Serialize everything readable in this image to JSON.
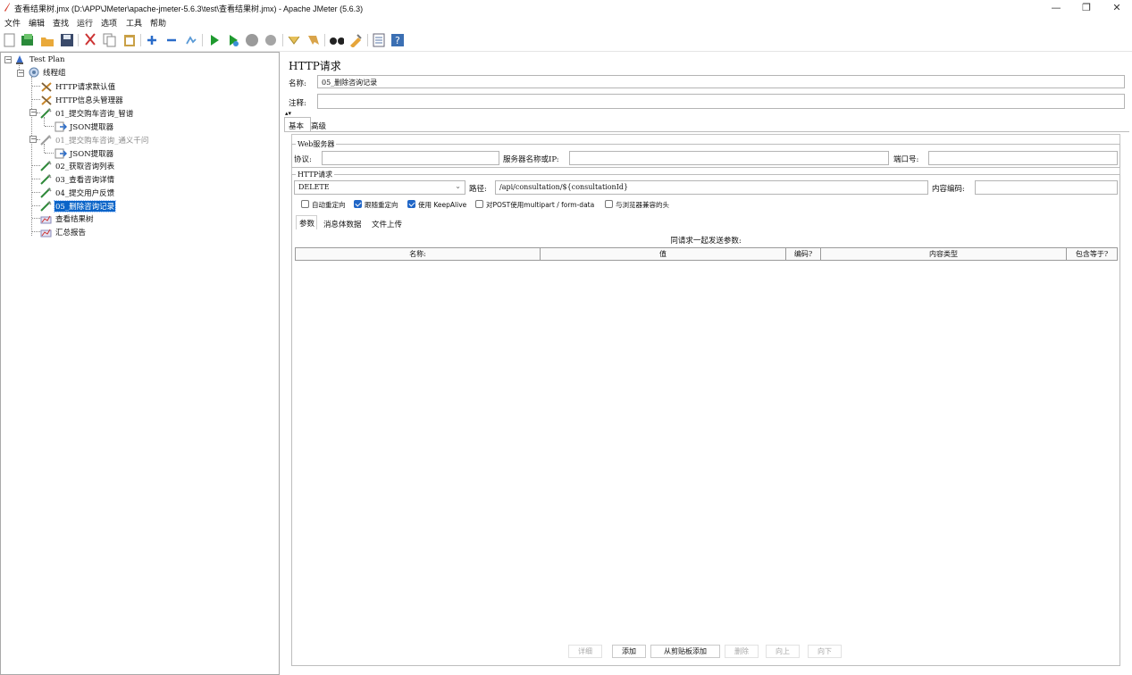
{
  "window": {
    "title": "查看结果树.jmx (D:\\APP\\JMeter\\apache-jmeter-5.6.3\\test\\查看结果树.jmx) - Apache JMeter (5.6.3)",
    "minimize": "—",
    "maximize": "❐",
    "close": "✕"
  },
  "menu": [
    "文件",
    "编辑",
    "查找",
    "运行",
    "选项",
    "工具",
    "帮助"
  ],
  "toolbar": {
    "icons": [
      "new-icon",
      "templates-icon",
      "open-icon",
      "save-icon",
      "cut-icon",
      "copy-icon",
      "paste-icon",
      "expand-icon",
      "collapse-icon",
      "toggle-icon",
      "start-icon",
      "start-no-pause-icon",
      "stop-icon",
      "shutdown-icon",
      "clear-icon",
      "clear-all-icon",
      "search-icon",
      "reset-search-icon",
      "function-helper-icon",
      "help-icon"
    ]
  },
  "tree": {
    "nodes": [
      {
        "label": "Test Plan",
        "icon": "test-plan-icon"
      },
      {
        "label": "线程组",
        "icon": "thread-group-icon"
      },
      {
        "label": "HTTP请求默认值",
        "icon": "config-icon"
      },
      {
        "label": "HTTP信息头管理器",
        "icon": "config-icon"
      },
      {
        "label": "01_提交购车咨询_智谱",
        "icon": "sampler-icon"
      },
      {
        "label": "JSON提取器",
        "icon": "extractor-icon"
      },
      {
        "label": "01_提交购车咨询_通义千问",
        "icon": "sampler-icon"
      },
      {
        "label": "JSON提取器",
        "icon": "extractor-icon"
      },
      {
        "label": "02_获取咨询列表",
        "icon": "sampler-icon"
      },
      {
        "label": "03_查看咨询详情",
        "icon": "sampler-icon"
      },
      {
        "label": "04_提交用户反馈",
        "icon": "sampler-icon"
      },
      {
        "label": "05_删除咨询记录",
        "icon": "sampler-icon"
      },
      {
        "label": "查看结果树",
        "icon": "listener-icon"
      },
      {
        "label": "汇总报告",
        "icon": "listener-icon"
      }
    ]
  },
  "panel": {
    "heading": "HTTP请求",
    "name_label": "名称:",
    "name_value": "05_删除咨询记录",
    "comment_label": "注释:",
    "comment_value": "",
    "tabs": [
      "基本",
      "高级"
    ],
    "web_server": {
      "title": "Web服务器",
      "protocol_label": "协议:",
      "protocol_value": "",
      "server_label": "服务器名称或IP:",
      "server_value": "",
      "port_label": "端口号:",
      "port_value": ""
    },
    "http_request": {
      "title": "HTTP请求",
      "method": "DELETE",
      "path_label": "路径:",
      "path_value": "/api/consultation/${consultationId}",
      "encoding_label": "内容编码:",
      "encoding_value": ""
    },
    "options": [
      {
        "label": "自动重定向",
        "checked": false
      },
      {
        "label": "跟随重定向",
        "checked": true
      },
      {
        "label": "使用 KeepAlive",
        "checked": true
      },
      {
        "label": "对POST使用multipart / form-data",
        "checked": false
      },
      {
        "label": "与浏览器兼容的头",
        "checked": false
      }
    ],
    "subtabs": [
      "参数",
      "消息体数据",
      "文件上传"
    ],
    "params_caption": "同请求一起发送参数:",
    "columns": [
      "名称:",
      "值",
      "编码?",
      "内容类型",
      "包含等于?"
    ],
    "buttons": {
      "detail": "详细",
      "add": "添加",
      "add_clipboard": "从剪贴板添加",
      "delete": "删除",
      "up": "向上",
      "down": "向下"
    }
  }
}
